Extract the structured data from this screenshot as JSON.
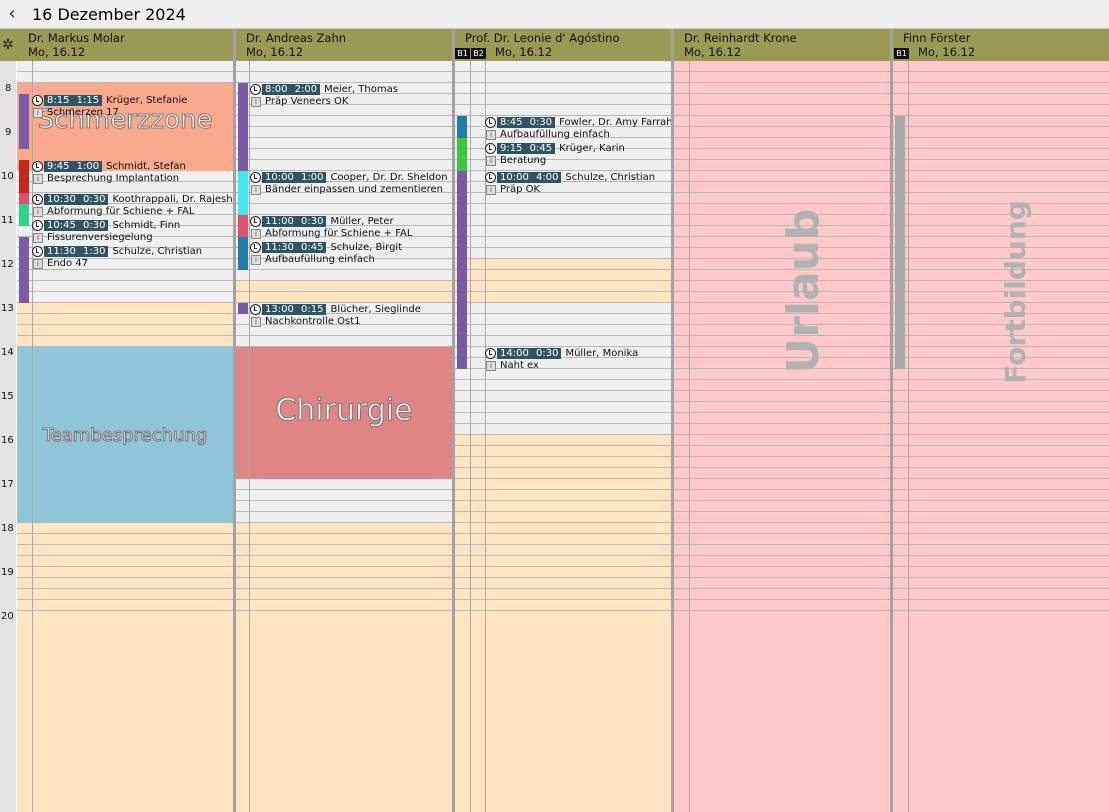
{
  "header": {
    "back_icon": "chevron-left-icon",
    "date": "16 Dezember 2024",
    "settings_icon": "gear-icon"
  },
  "hours": [
    "8",
    "9",
    "10",
    "11",
    "12",
    "13",
    "14",
    "15",
    "16",
    "17",
    "18",
    "19",
    "20"
  ],
  "columns": [
    {
      "name": "Dr. Markus Molar",
      "day": "Mo,  16.12",
      "badges": []
    },
    {
      "name": "Dr. Andreas Zahn",
      "day": "Mo,  16.12",
      "badges": []
    },
    {
      "name": "Prof. Dr. Leonie d' Agóstino",
      "day": "Mo,  16.12",
      "badges": [
        "B1",
        "B2"
      ]
    },
    {
      "name": "Dr. Reinhardt Krone",
      "day": "Mo,  16.12",
      "badges": []
    },
    {
      "name": "Finn Förster",
      "day": "Mo,  16.12",
      "badges": [
        "B1"
      ]
    }
  ],
  "blocks": {
    "schmerzzone": "Schmerzzone",
    "teambesprechung": "Teambesprechung",
    "chirurgie": "Chirurgie",
    "urlaub": "Urlaub",
    "fortbildung": "Fortbildung"
  },
  "appointments": {
    "c1": [
      {
        "time": "8:15 1:15",
        "patient": "Krüger, Stefanie",
        "note": "Schmerzen 17"
      },
      {
        "time": "9:45 1:00",
        "patient": "Schmidt, Stefan",
        "note": "Besprechung Implantation"
      },
      {
        "time": "10:30 0:30",
        "patient": "Koothrappali, Dr. Rajesh Ra",
        "note": "Abformung für Schiene + FAL"
      },
      {
        "time": "10:45 0:30",
        "patient": "Schmidt, Finn",
        "note": "Fissurenversiegelung"
      },
      {
        "time": "11:30 1:30",
        "patient": "Schulze, Christian",
        "note": "Endo 47"
      }
    ],
    "c2": [
      {
        "time": "8:00 2:00",
        "patient": "Meier, Thomas",
        "note": "Präp  Veneers OK"
      },
      {
        "time": "10:00 1:00",
        "patient": "Cooper, Dr. Dr. Sheldon L",
        "note": "Bänder einpassen und zementieren"
      },
      {
        "time": "11:00 0:30",
        "patient": "Müller, Peter",
        "note": "Abformung für Schiene + FAL"
      },
      {
        "time": "11:30 0:45",
        "patient": "Schulze, Birgit",
        "note": "Aufbaufüllung einfach"
      },
      {
        "time": "13:00 0:15",
        "patient": "Blücher, Sieglinde",
        "note": "Nachkontrolle Ost1"
      }
    ],
    "c3": [
      {
        "time": "8:45 0:30",
        "patient": "Fowler, Dr. Amy Farrah",
        "note": "Aufbaufüllung einfach"
      },
      {
        "time": "9:15 0:45",
        "patient": "Krüger, Karin",
        "note": "Beratung"
      },
      {
        "time": "10:00 4:00",
        "patient": "Schulze, Christian",
        "note": "Präp OK"
      },
      {
        "time": "14:00 0:30",
        "patient": "Müller, Monika",
        "note": "Naht ex"
      }
    ]
  },
  "colors": {
    "header": "#9b9a55",
    "free": "#ffe5c1",
    "absent": "#ffc9c9",
    "team": "#8fc6da",
    "surgery": "#e08585",
    "pain": "#f9a98c",
    "time_badge": "#2f5565"
  }
}
